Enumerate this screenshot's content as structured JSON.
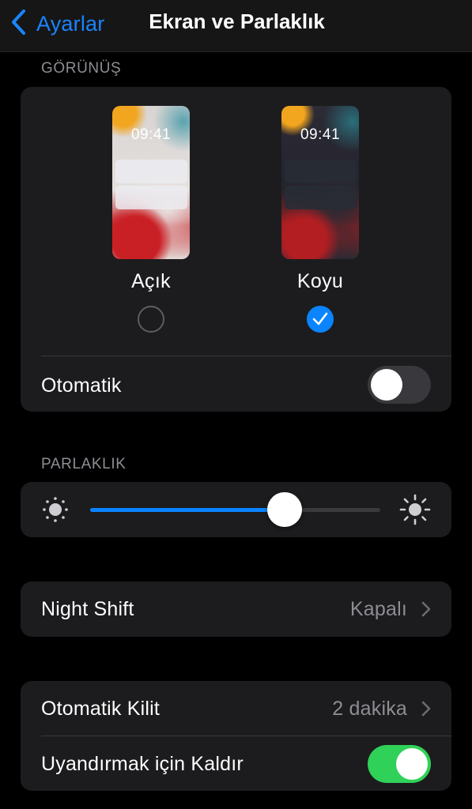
{
  "navbar": {
    "back_label": "Ayarlar",
    "title": "Ekran ve Parlaklık"
  },
  "appearance": {
    "header": "GÖRÜNÜŞ",
    "light": {
      "time": "09:41",
      "label": "Açık",
      "selected": false
    },
    "dark": {
      "time": "09:41",
      "label": "Koyu",
      "selected": true
    },
    "automatic_label": "Otomatik",
    "automatic_on": false
  },
  "brightness": {
    "header": "PARLAKLIK",
    "level": 0.67,
    "low_icon": "sun-low-icon",
    "high_icon": "sun-high-icon"
  },
  "night_shift": {
    "label": "Night Shift",
    "value": "Kapalı"
  },
  "lock": {
    "auto_lock_label": "Otomatik Kilit",
    "auto_lock_value": "2 dakika",
    "raise_to_wake_label": "Uyandırmak için Kaldır",
    "raise_to_wake_on": true
  },
  "colors": {
    "accent": "#0a84ff",
    "toggle_on": "#30d158",
    "background": "#000000",
    "card": "#1c1c1e"
  }
}
